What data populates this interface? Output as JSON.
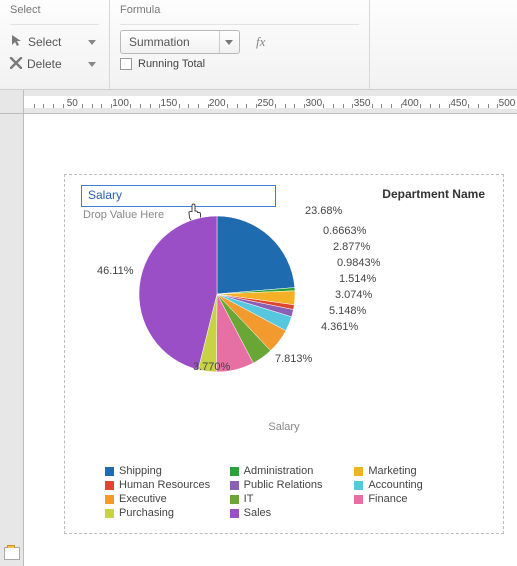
{
  "ribbon": {
    "select_group_title": "Select",
    "select_label": "Select",
    "delete_label": "Delete",
    "formula_group_title": "Formula",
    "formula_value": "Summation",
    "fx_label": "fx",
    "running_total_label": "Running Total"
  },
  "ruler": {
    "majors": [
      50,
      100,
      150,
      200,
      250,
      300,
      350,
      400,
      450,
      500
    ]
  },
  "chart": {
    "column_title": "Department Name",
    "field_value": "Salary",
    "drop_hint": "Drop Value Here",
    "axis_title": "Salary"
  },
  "labels": {
    "shipping": "23.68%",
    "admin": "0.6663%",
    "marketing": "2.877%",
    "hr": "0.9843%",
    "pr": "1.514%",
    "accounting": "3.074%",
    "executive": "5.148%",
    "it": "4.361%",
    "finance": "7.813%",
    "purchasing": "3.770%",
    "sales": "46.11%"
  },
  "legend": {
    "shipping": "Shipping",
    "admin": "Administration",
    "marketing": "Marketing",
    "hr": "Human Resources",
    "pr": "Public Relations",
    "accounting": "Accounting",
    "executive": "Executive",
    "it": "IT",
    "finance": "Finance",
    "purchasing": "Purchasing",
    "sales": "Sales"
  },
  "colors": {
    "shipping": "#1f6bb0",
    "admin": "#2aa336",
    "marketing": "#f4b026",
    "hr": "#e0452f",
    "pr": "#8a5fb4",
    "accounting": "#55c7df",
    "executive": "#f29a2e",
    "it": "#6aa635",
    "finance": "#e66fa4",
    "purchasing": "#c8d245",
    "sales": "#9b4fc6"
  },
  "chart_data": {
    "type": "pie",
    "title": "Salary",
    "column": "Department Name",
    "series": [
      {
        "name": "Shipping",
        "value": 23.68
      },
      {
        "name": "Administration",
        "value": 0.6663
      },
      {
        "name": "Marketing",
        "value": 2.877
      },
      {
        "name": "Human Resources",
        "value": 0.9843
      },
      {
        "name": "Public Relations",
        "value": 1.514
      },
      {
        "name": "Accounting",
        "value": 3.074
      },
      {
        "name": "Executive",
        "value": 5.148
      },
      {
        "name": "IT",
        "value": 4.361
      },
      {
        "name": "Finance",
        "value": 7.813
      },
      {
        "name": "Purchasing",
        "value": 3.77
      },
      {
        "name": "Sales",
        "value": 46.11
      }
    ]
  }
}
